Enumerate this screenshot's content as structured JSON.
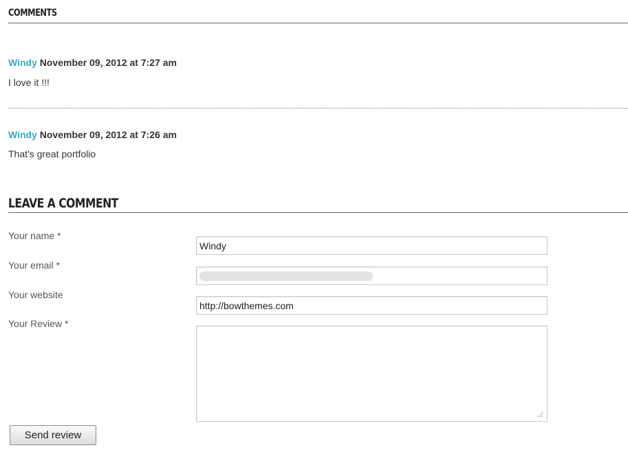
{
  "comments_section": {
    "heading": "COMMENTS",
    "items": [
      {
        "author": "Windy",
        "date": "November 09, 2012 at 7:27 am",
        "text": "I love it !!!"
      },
      {
        "author": "Windy",
        "date": "November 09, 2012 at 7:26 am",
        "text": "That's great portfolio"
      }
    ]
  },
  "form": {
    "heading": "LEAVE A COMMENT",
    "name_label": "Your name *",
    "name_value": "Windy",
    "email_label": "Your email *",
    "email_value": "",
    "website_label": "Your website",
    "website_value": "http://bowthemes.com",
    "review_label": "Your Review *",
    "review_value": "",
    "submit_label": "Send review"
  },
  "colors": {
    "author_link": "#31a8c9",
    "text": "#333333"
  }
}
